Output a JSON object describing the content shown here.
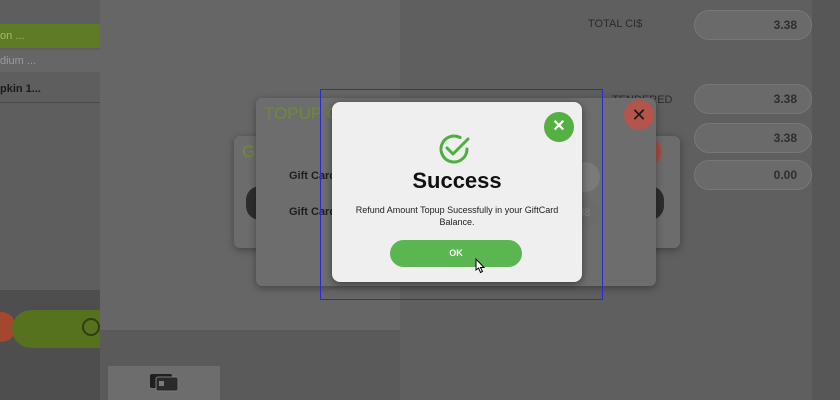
{
  "background": {
    "left_list": {
      "row1": "on ...",
      "row2": "dium ...",
      "row3": "pkin 1..."
    },
    "totals": {
      "total_label": "TOTAL CI$",
      "total_value": "3.38",
      "tendered_label": "TENDERED",
      "tendered_value": "3.38",
      "value2": "3.38",
      "value3": "0.00"
    }
  },
  "modals": {
    "back_title": "Gi",
    "mid_title": "TOPUP G",
    "gift_card_label_1": "Gift Card",
    "gift_card_label_2": "Gift Card",
    "field2_partial": "38"
  },
  "success_dialog": {
    "title": "Success",
    "message": "Refund Amount Topup Sucessfully in your GiftCard Balance.",
    "ok_label": "OK",
    "close_glyph": "✕"
  },
  "mid_modal_close_glyph": "✕",
  "colors": {
    "success_green": "#5bb551",
    "close_red": "#f07c6c",
    "brand_green": "#8bc34a"
  }
}
